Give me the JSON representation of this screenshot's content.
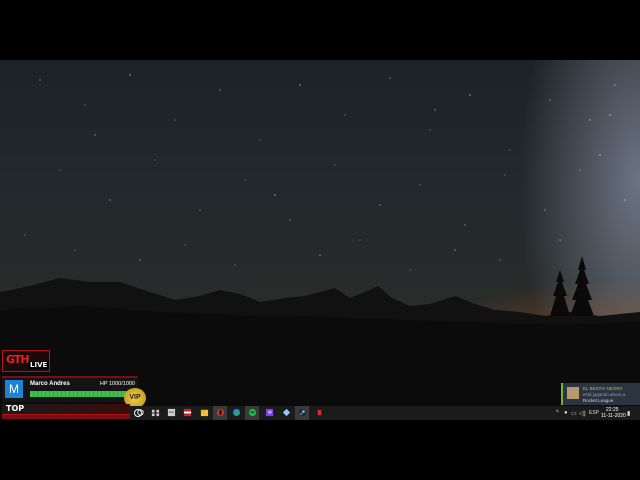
{
  "overlay": {
    "logo_text": "GTH",
    "live_label": "LIVE",
    "user": {
      "avatar_letter": "M",
      "name": "Marco Andres",
      "hp_text": "HP 1000/1000",
      "hp_fraction": 1.0
    },
    "vip_label": "VIP",
    "top_label": "TOP"
  },
  "notification": {
    "line1": "EL BESTIA NEGRA",
    "line2": "está jugando ahora a",
    "line3": "Rocket League"
  },
  "taskbar": {
    "pinned_icons": [
      "search-icon",
      "task-view-icon",
      "app-icon-red",
      "file-explorer-icon",
      "folder-icon",
      "opera-icon",
      "edge-icon",
      "spotify-icon",
      "app-icon-gold",
      "twitch-icon",
      "app-icon-blue",
      "steam-icon",
      "app-icon-red-small"
    ],
    "tray": {
      "lang": "ESP",
      "time": "22:25",
      "date": "11-11-2020"
    }
  },
  "colors": {
    "accent_red": "#b01515",
    "hp_green": "#3fbf52",
    "vip_gold": "#f2d04a",
    "steam_green": "#6fb540"
  }
}
